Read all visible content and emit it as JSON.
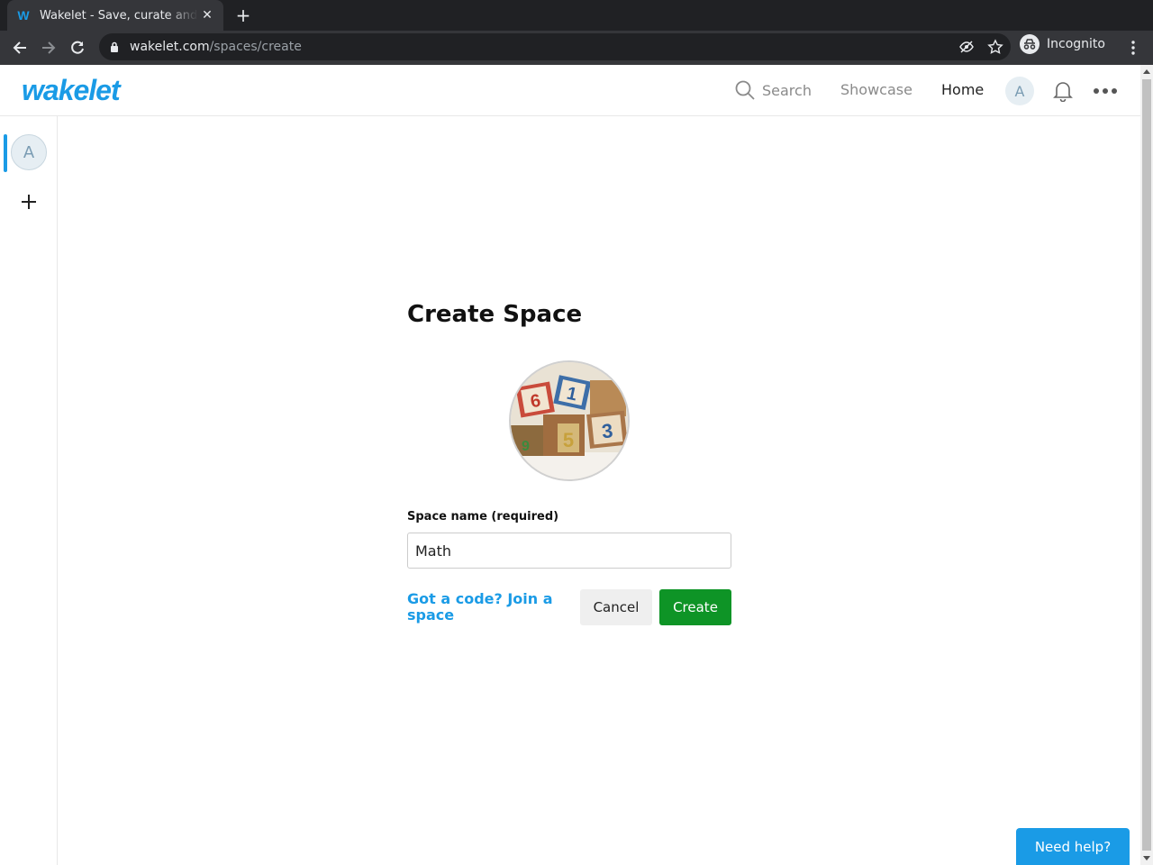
{
  "browser": {
    "tab_title": "Wakelet - Save, curate and share",
    "tab_favicon": "W",
    "url_domain": "wakelet.com",
    "url_path": "/spaces/create",
    "profile_label": "Incognito"
  },
  "header": {
    "logo": "wakelet",
    "search_label": "Search",
    "showcase_label": "Showcase",
    "home_label": "Home",
    "avatar_initial": "A"
  },
  "sidebar": {
    "avatar_initial": "A"
  },
  "form": {
    "title": "Create Space",
    "cover_image": "number-blocks-image",
    "name_label": "Space name (required)",
    "name_value": "Math",
    "join_link": "Got a code? Join a space",
    "cancel_label": "Cancel",
    "create_label": "Create"
  },
  "help_button": "Need help?",
  "colors": {
    "brand": "#1a9be6",
    "create_button": "#0e9426"
  }
}
